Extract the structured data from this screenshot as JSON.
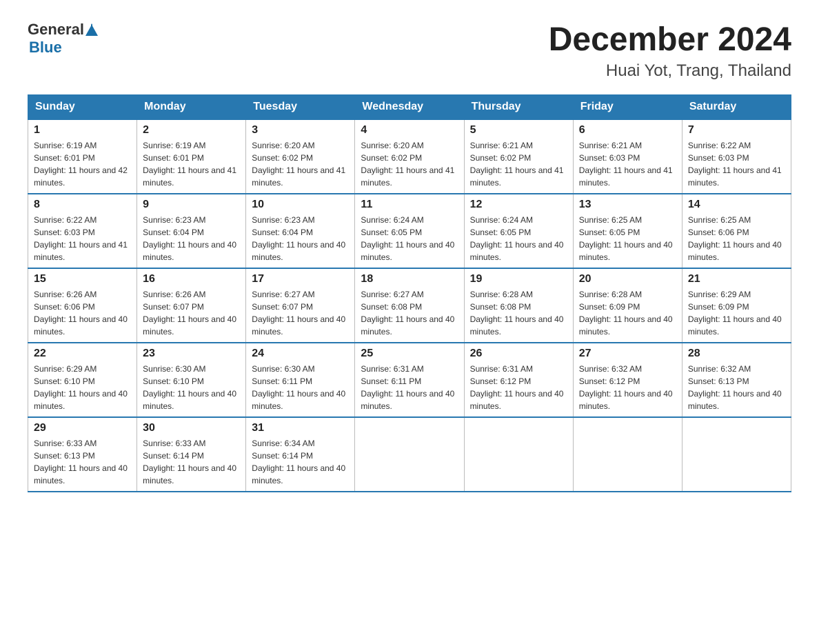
{
  "header": {
    "logo_general": "General",
    "logo_blue": "Blue",
    "month_year": "December 2024",
    "location": "Huai Yot, Trang, Thailand"
  },
  "days_of_week": [
    "Sunday",
    "Monday",
    "Tuesday",
    "Wednesday",
    "Thursday",
    "Friday",
    "Saturday"
  ],
  "weeks": [
    [
      {
        "day": "1",
        "sunrise": "6:19 AM",
        "sunset": "6:01 PM",
        "daylight": "11 hours and 42 minutes."
      },
      {
        "day": "2",
        "sunrise": "6:19 AM",
        "sunset": "6:01 PM",
        "daylight": "11 hours and 41 minutes."
      },
      {
        "day": "3",
        "sunrise": "6:20 AM",
        "sunset": "6:02 PM",
        "daylight": "11 hours and 41 minutes."
      },
      {
        "day": "4",
        "sunrise": "6:20 AM",
        "sunset": "6:02 PM",
        "daylight": "11 hours and 41 minutes."
      },
      {
        "day": "5",
        "sunrise": "6:21 AM",
        "sunset": "6:02 PM",
        "daylight": "11 hours and 41 minutes."
      },
      {
        "day": "6",
        "sunrise": "6:21 AM",
        "sunset": "6:03 PM",
        "daylight": "11 hours and 41 minutes."
      },
      {
        "day": "7",
        "sunrise": "6:22 AM",
        "sunset": "6:03 PM",
        "daylight": "11 hours and 41 minutes."
      }
    ],
    [
      {
        "day": "8",
        "sunrise": "6:22 AM",
        "sunset": "6:03 PM",
        "daylight": "11 hours and 41 minutes."
      },
      {
        "day": "9",
        "sunrise": "6:23 AM",
        "sunset": "6:04 PM",
        "daylight": "11 hours and 40 minutes."
      },
      {
        "day": "10",
        "sunrise": "6:23 AM",
        "sunset": "6:04 PM",
        "daylight": "11 hours and 40 minutes."
      },
      {
        "day": "11",
        "sunrise": "6:24 AM",
        "sunset": "6:05 PM",
        "daylight": "11 hours and 40 minutes."
      },
      {
        "day": "12",
        "sunrise": "6:24 AM",
        "sunset": "6:05 PM",
        "daylight": "11 hours and 40 minutes."
      },
      {
        "day": "13",
        "sunrise": "6:25 AM",
        "sunset": "6:05 PM",
        "daylight": "11 hours and 40 minutes."
      },
      {
        "day": "14",
        "sunrise": "6:25 AM",
        "sunset": "6:06 PM",
        "daylight": "11 hours and 40 minutes."
      }
    ],
    [
      {
        "day": "15",
        "sunrise": "6:26 AM",
        "sunset": "6:06 PM",
        "daylight": "11 hours and 40 minutes."
      },
      {
        "day": "16",
        "sunrise": "6:26 AM",
        "sunset": "6:07 PM",
        "daylight": "11 hours and 40 minutes."
      },
      {
        "day": "17",
        "sunrise": "6:27 AM",
        "sunset": "6:07 PM",
        "daylight": "11 hours and 40 minutes."
      },
      {
        "day": "18",
        "sunrise": "6:27 AM",
        "sunset": "6:08 PM",
        "daylight": "11 hours and 40 minutes."
      },
      {
        "day": "19",
        "sunrise": "6:28 AM",
        "sunset": "6:08 PM",
        "daylight": "11 hours and 40 minutes."
      },
      {
        "day": "20",
        "sunrise": "6:28 AM",
        "sunset": "6:09 PM",
        "daylight": "11 hours and 40 minutes."
      },
      {
        "day": "21",
        "sunrise": "6:29 AM",
        "sunset": "6:09 PM",
        "daylight": "11 hours and 40 minutes."
      }
    ],
    [
      {
        "day": "22",
        "sunrise": "6:29 AM",
        "sunset": "6:10 PM",
        "daylight": "11 hours and 40 minutes."
      },
      {
        "day": "23",
        "sunrise": "6:30 AM",
        "sunset": "6:10 PM",
        "daylight": "11 hours and 40 minutes."
      },
      {
        "day": "24",
        "sunrise": "6:30 AM",
        "sunset": "6:11 PM",
        "daylight": "11 hours and 40 minutes."
      },
      {
        "day": "25",
        "sunrise": "6:31 AM",
        "sunset": "6:11 PM",
        "daylight": "11 hours and 40 minutes."
      },
      {
        "day": "26",
        "sunrise": "6:31 AM",
        "sunset": "6:12 PM",
        "daylight": "11 hours and 40 minutes."
      },
      {
        "day": "27",
        "sunrise": "6:32 AM",
        "sunset": "6:12 PM",
        "daylight": "11 hours and 40 minutes."
      },
      {
        "day": "28",
        "sunrise": "6:32 AM",
        "sunset": "6:13 PM",
        "daylight": "11 hours and 40 minutes."
      }
    ],
    [
      {
        "day": "29",
        "sunrise": "6:33 AM",
        "sunset": "6:13 PM",
        "daylight": "11 hours and 40 minutes."
      },
      {
        "day": "30",
        "sunrise": "6:33 AM",
        "sunset": "6:14 PM",
        "daylight": "11 hours and 40 minutes."
      },
      {
        "day": "31",
        "sunrise": "6:34 AM",
        "sunset": "6:14 PM",
        "daylight": "11 hours and 40 minutes."
      },
      null,
      null,
      null,
      null
    ]
  ]
}
